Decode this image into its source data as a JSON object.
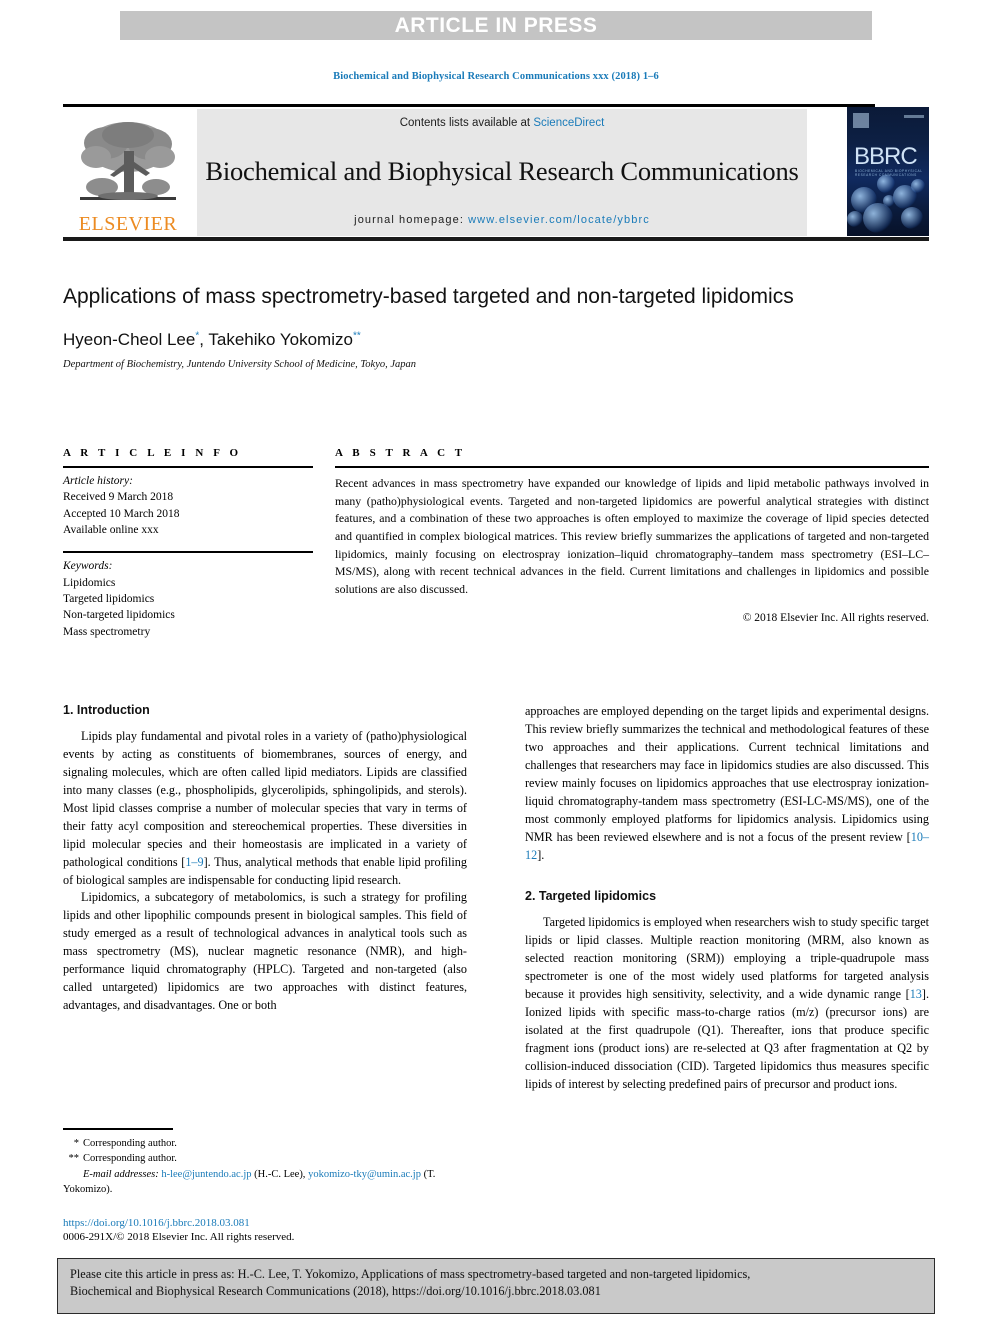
{
  "banner": {
    "label": "ARTICLE IN PRESS",
    "bg_color": "#c4c4c4",
    "text_color": "#ffffff"
  },
  "running_head": "Biochemical and Biophysical Research Communications xxx (2018) 1–6",
  "masthead": {
    "contents_prefix": "Contents lists available at ",
    "contents_link": "ScienceDirect",
    "journal_title": "Biochemical and Biophysical Research Communications",
    "homepage_label": "journal homepage: ",
    "homepage_url": "www.elsevier.com/locate/ybbrc",
    "publisher_name": "ELSEVIER",
    "publisher_color": "#ec8b22",
    "cover_acronym": "BBRC",
    "cover_subtitle": "BIOCHEMICAL AND BIOPHYSICAL RESEARCH COMMUNICATIONS",
    "link_color": "#1a7bb9"
  },
  "article": {
    "title": "Applications of mass spectrometry-based targeted and non-targeted lipidomics",
    "authors": "Hyeon-Cheol Lee, Takehiko Yokomizo",
    "author_1": "Hyeon-Cheol Lee",
    "author_1_mark": "*",
    "author_2": "Takehiko Yokomizo",
    "author_2_mark": "**",
    "affiliation": "Department of Biochemistry, Juntendo University School of Medicine, Tokyo, Japan"
  },
  "article_info": {
    "heading": "A R T I C L E  I N F O",
    "history_label": "Article history:",
    "history": [
      "Received 9 March 2018",
      "Accepted 10 March 2018",
      "Available online xxx"
    ],
    "keywords_label": "Keywords:",
    "keywords": [
      "Lipidomics",
      "Targeted lipidomics",
      "Non-targeted lipidomics",
      "Mass spectrometry"
    ]
  },
  "abstract": {
    "heading": "A B S T R A C T",
    "text": "Recent advances in mass spectrometry have expanded our knowledge of lipids and lipid metabolic pathways involved in many (patho)physiological events. Targeted and non-targeted lipidomics are powerful analytical strategies with distinct features, and a combination of these two approaches is often employed to maximize the coverage of lipid species detected and quantified in complex biological matrices. This review briefly summarizes the applications of targeted and non-targeted lipidomics, mainly focusing on electrospray ionization–liquid chromatography–tandem mass spectrometry (ESI–LC–MS/MS), along with recent technical advances in the field. Current limitations and challenges in lipidomics and possible solutions are also discussed.",
    "copyright": "© 2018 Elsevier Inc. All rights reserved."
  },
  "body": {
    "section_1_heading": "1. Introduction",
    "p1_a": "Lipids play fundamental and pivotal roles in a variety of (patho)physiological events by acting as constituents of biomembranes, sources of energy, and signaling molecules, which are often called lipid mediators. Lipids are classified into many classes (e.g., phospholipids, glycerolipids, sphingolipids, and sterols). Most lipid classes comprise a number of molecular species that vary in terms of their fatty acyl composition and stereochemical properties. These diversities in lipid molecular species and their homeostasis are implicated in a variety of pathological conditions [",
    "p1_ref": "1–9",
    "p1_b": "]. Thus, analytical methods that enable lipid profiling of biological samples are indispensable for conducting lipid research.",
    "p2": "Lipidomics, a subcategory of metabolomics, is such a strategy for profiling lipids and other lipophilic compounds present in biological samples. This field of study emerged as a result of technological advances in analytical tools such as mass spectrometry (MS), nuclear magnetic resonance (NMR), and high-performance liquid chromatography (HPLC). Targeted and non-targeted (also called untargeted) lipidomics are two approaches with distinct features, advantages, and disadvantages. One or both",
    "p3_a": "approaches are employed depending on the target lipids and experimental designs. This review briefly summarizes the technical and methodological features of these two approaches and their applications. Current technical limitations and challenges that researchers may face in lipidomics studies are also discussed. This review mainly focuses on lipidomics approaches that use electrospray ionization-liquid chromatography-tandem mass spectrometry (ESI-LC-MS/MS), one of the most commonly employed platforms for lipidomics analysis. Lipidomics using NMR has been reviewed elsewhere and is not a focus of the present review [",
    "p3_ref": "10–12",
    "p3_b": "].",
    "section_2_heading": "2. Targeted lipidomics",
    "p4_a": "Targeted lipidomics is employed when researchers wish to study specific target lipids or lipid classes. Multiple reaction monitoring (MRM, also known as selected reaction monitoring (SRM)) employing a triple-quadrupole mass spectrometer is one of the most widely used platforms for targeted analysis because it provides high sensitivity, selectivity, and a wide dynamic range [",
    "p4_ref": "13",
    "p4_b": "]. Ionized lipids with specific mass-to-charge ratios (m/z) (precursor ions) are isolated at the first quadrupole (Q1). Thereafter, ions that produce specific fragment ions (product ions) are re-selected at Q3 after fragmentation at Q2 by collision-induced dissociation (CID). Targeted lipidomics thus measures specific lipids of interest by selecting predefined pairs of precursor and product ions."
  },
  "footnotes": {
    "corresponding_1_mark": "*",
    "corresponding_1": "Corresponding author.",
    "corresponding_2_mark": "**",
    "corresponding_2": "Corresponding author.",
    "email_label": "E-mail addresses:",
    "email_1": "h-lee@juntendo.ac.jp",
    "email_1_owner": "(H.-C. Lee),",
    "email_2": "yokomizo-tky@umin.ac.jp",
    "email_2_owner": "(T. Yokomizo).",
    "doi": "https://doi.org/10.1016/j.bbrc.2018.03.081",
    "issn": "0006-291X/© 2018 Elsevier Inc. All rights reserved."
  },
  "cite_box": {
    "line1": "Please cite this article in press as: H.-C. Lee, T. Yokomizo, Applications of mass spectrometry-based targeted and non-targeted lipidomics,",
    "line2": "Biochemical and Biophysical Research Communications (2018), https://doi.org/10.1016/j.bbrc.2018.03.081"
  }
}
